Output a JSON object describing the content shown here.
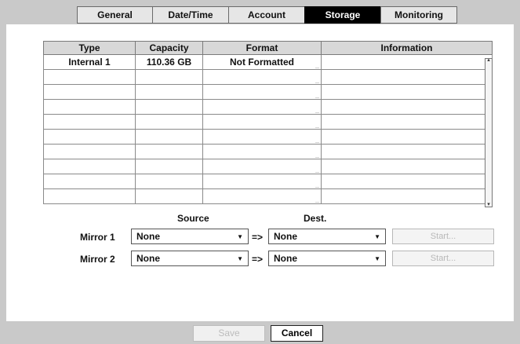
{
  "tabs": [
    {
      "label": "General",
      "active": false
    },
    {
      "label": "Date/Time",
      "active": false
    },
    {
      "label": "Account",
      "active": false
    },
    {
      "label": "Storage",
      "active": true
    },
    {
      "label": "Monitoring",
      "active": false
    }
  ],
  "table": {
    "headers": [
      "Type",
      "Capacity",
      "Format",
      "Information"
    ],
    "rows": [
      [
        "Internal 1",
        "110.36 GB",
        "Not Formatted",
        ""
      ],
      [
        "",
        "",
        "",
        ""
      ],
      [
        "",
        "",
        "",
        ""
      ],
      [
        "",
        "",
        "",
        ""
      ],
      [
        "",
        "",
        "",
        ""
      ],
      [
        "",
        "",
        "",
        ""
      ],
      [
        "",
        "",
        "",
        ""
      ],
      [
        "",
        "",
        "",
        ""
      ],
      [
        "",
        "",
        "",
        ""
      ],
      [
        "",
        "",
        "",
        ""
      ]
    ]
  },
  "mirror": {
    "source_label": "Source",
    "dest_label": "Dest.",
    "arrow": "=>",
    "rows": [
      {
        "label": "Mirror 1",
        "source": "None",
        "dest": "None",
        "start": "Start..."
      },
      {
        "label": "Mirror 2",
        "source": "None",
        "dest": "None",
        "start": "Start..."
      }
    ]
  },
  "footer": {
    "save": "Save",
    "cancel": "Cancel"
  },
  "colors": {
    "active_tab": "#000000",
    "background": "#c9c9c9",
    "panel": "#ffffff"
  }
}
